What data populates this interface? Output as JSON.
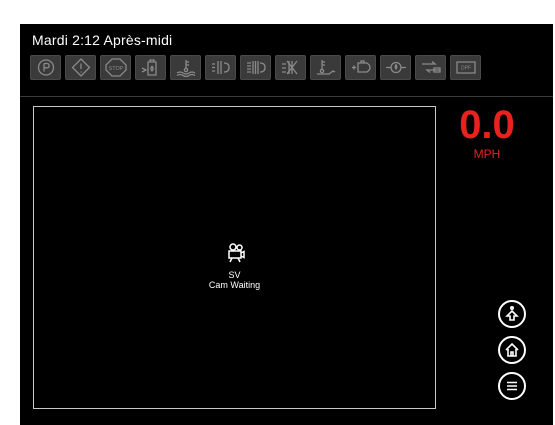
{
  "status_bar": {
    "clock": "Mardi 2:12 Après-midi"
  },
  "telltales": [
    {
      "icon": "parking-brake-icon"
    },
    {
      "icon": "warning-icon"
    },
    {
      "icon": "stop-icon",
      "text": "STOP"
    },
    {
      "icon": "fuel-water-icon"
    },
    {
      "icon": "coolant-temperature-icon"
    },
    {
      "icon": "air-filter-icon"
    },
    {
      "icon": "hydraulic-filter-icon"
    },
    {
      "icon": "filter-bypass-icon"
    },
    {
      "icon": "hydraulic-temperature-icon"
    },
    {
      "icon": "engine-icon"
    },
    {
      "icon": "oil-pressure-icon"
    },
    {
      "icon": "transmission-icon"
    },
    {
      "icon": "dpf-icon",
      "text": "DPF"
    }
  ],
  "camera": {
    "name": "SV",
    "status": "Cam Waiting",
    "icon": "camera-icon"
  },
  "speed": {
    "value": "0.0",
    "unit": "MPH",
    "color": "#e8231f"
  },
  "nav_buttons": [
    {
      "icon": "nav-up-icon"
    },
    {
      "icon": "home-icon"
    },
    {
      "icon": "menu-icon"
    }
  ],
  "colors": {
    "background": "#000000",
    "telltale_bg": "#3a3a3a",
    "accent": "#e8231f"
  }
}
